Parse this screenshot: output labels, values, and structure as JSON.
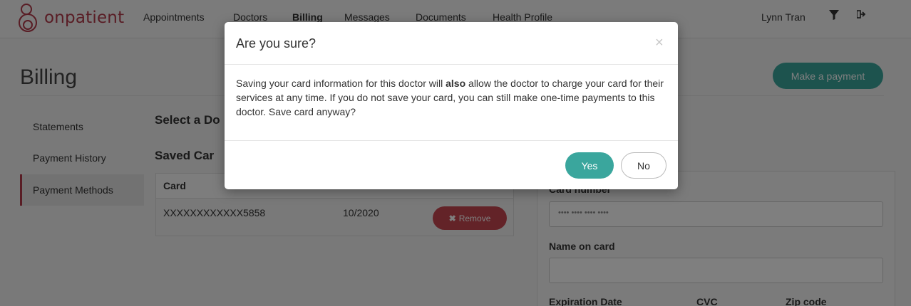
{
  "brand": {
    "name": "onpatient",
    "color": "#b23b4a"
  },
  "nav": {
    "links": [
      "Appointments",
      "Doctors",
      "Billing",
      "Messages",
      "Documents",
      "Health Profile"
    ],
    "active": "Billing",
    "user": "Lynn Tran",
    "filter_icon": "filter-icon",
    "logout_icon": "logout-icon"
  },
  "page": {
    "title": "Billing",
    "make_payment": "Make a payment",
    "accent_color": "#3aa69d"
  },
  "sidebar": {
    "items": [
      {
        "label": "Statements"
      },
      {
        "label": "Payment History"
      },
      {
        "label": "Payment Methods"
      }
    ],
    "active": "Payment Methods"
  },
  "main": {
    "select_heading": "Select a Do",
    "saved_cards_heading": "Saved Car",
    "table": {
      "header_card": "Card",
      "rows": [
        {
          "card": "XXXXXXXXXXXX5858",
          "expiration": "10/2020",
          "remove_label": "Remove"
        }
      ]
    }
  },
  "card_form": {
    "card_number_label": "Card number",
    "card_number_placeholder": "•••• •••• •••• ••••",
    "name_label": "Name on card",
    "expiration_label": "Expiration Date",
    "cvc_label": "CVC",
    "zip_label": "Zip code"
  },
  "modal": {
    "title": "Are you sure?",
    "close": "×",
    "body_before": "Saving your card information for this doctor will ",
    "body_bold": "also",
    "body_after": " allow the doctor to charge your card for their services at any time. If you do not save your card, you can still make one-time payments to this doctor. Save card anyway?",
    "yes_label": "Yes",
    "no_label": "No"
  }
}
